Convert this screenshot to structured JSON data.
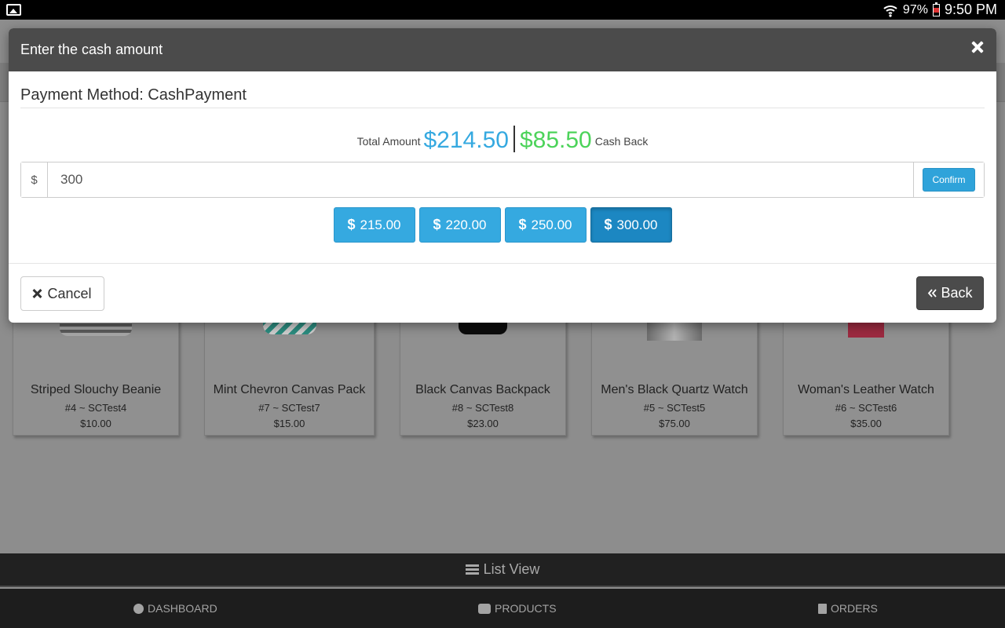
{
  "status_bar": {
    "battery": "97%",
    "time": "9:50 PM",
    "icons": [
      "gallery-icon",
      "wifi-icon",
      "battery-icon"
    ]
  },
  "modal": {
    "title": "Enter the cash amount",
    "payment_method": "Payment Method: CashPayment",
    "total_label": "Total Amount",
    "total_value": "$214.50",
    "cashback_value": "$85.50",
    "cashback_label": "Cash Back",
    "currency_symbol": "$",
    "cash_input_value": "300",
    "confirm_label": "Confirm",
    "quick_amounts": [
      {
        "label": "215.00",
        "active": false
      },
      {
        "label": "220.00",
        "active": false
      },
      {
        "label": "250.00",
        "active": false
      },
      {
        "label": "300.00",
        "active": true
      }
    ],
    "cancel_label": "Cancel",
    "back_label": "Back"
  },
  "products": [
    {
      "name": "Striped Slouchy Beanie",
      "sku": "#4 ~ SCTest4",
      "price": "$10.00"
    },
    {
      "name": "Mint Chevron Canvas Pack",
      "sku": "#7 ~ SCTest7",
      "price": "$15.00"
    },
    {
      "name": "Black Canvas Backpack",
      "sku": "#8 ~ SCTest8",
      "price": "$23.00"
    },
    {
      "name": "Men's Black Quartz Watch",
      "sku": "#5 ~ SCTest5",
      "price": "$75.00"
    },
    {
      "name": "Woman's Leather Watch",
      "sku": "#6 ~ SCTest6",
      "price": "$35.00"
    }
  ],
  "list_view_label": "List View",
  "nav": {
    "dashboard": "DASHBOARD",
    "products": "PRODUCTS",
    "orders": "ORDERS"
  },
  "colors": {
    "total": "#35a9e0",
    "cashback": "#4cd35a",
    "header": "#4b4b4b",
    "primary_button": "#35a9e0"
  }
}
